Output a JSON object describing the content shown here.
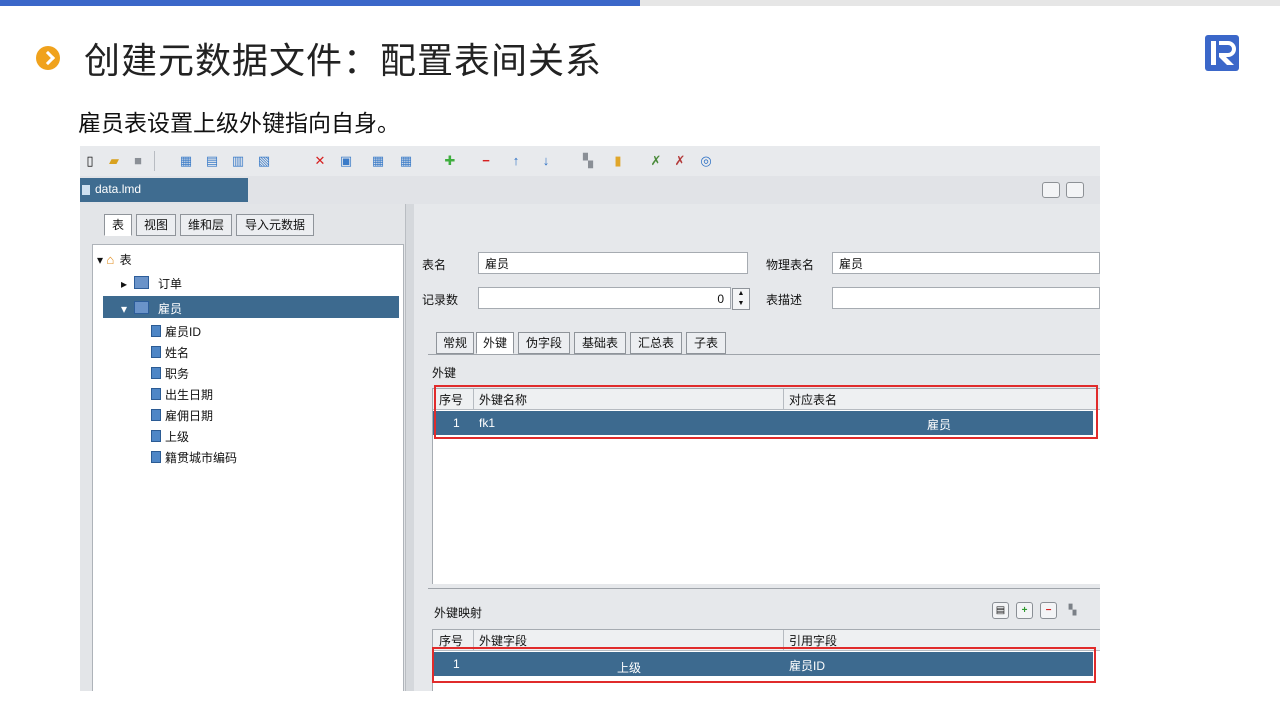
{
  "slide": {
    "title": "创建元数据文件：配置表间关系",
    "subtitle": "雇员表设置上级外键指向自身。"
  },
  "colors": {
    "accent_blue": "#3b67c9",
    "bullet_orange": "#f0a21c",
    "selection": "#3d6a8f",
    "highlight_red": "#e02b2b"
  },
  "app": {
    "file_tab": "data.lmd",
    "left_tabs": [
      "表",
      "视图",
      "维和层",
      "导入元数据"
    ],
    "tree": {
      "root": "表",
      "tables": [
        "订单",
        "雇员"
      ],
      "fields": [
        "雇员ID",
        "姓名",
        "职务",
        "出生日期",
        "雇佣日期",
        "上级",
        "籍贯城市编码"
      ]
    },
    "form": {
      "table_name_label": "表名",
      "table_name_value": "雇员",
      "physical_name_label": "物理表名",
      "physical_name_value": "雇员",
      "record_count_label": "记录数",
      "record_count_value": "0",
      "description_label": "表描述",
      "description_value": ""
    },
    "inner_tabs": [
      "常规",
      "外键",
      "伪字段",
      "基础表",
      "汇总表",
      "子表"
    ],
    "fk_section": {
      "title": "外键",
      "headers": [
        "序号",
        "外键名称",
        "对应表名"
      ],
      "rows": [
        {
          "no": "1",
          "name": "fk1",
          "table": "雇员"
        }
      ]
    },
    "mapping_section": {
      "title": "外键映射",
      "headers": [
        "序号",
        "外键字段",
        "引用字段"
      ],
      "rows": [
        {
          "no": "1",
          "field": "上级",
          "ref": "雇员ID"
        }
      ]
    }
  }
}
